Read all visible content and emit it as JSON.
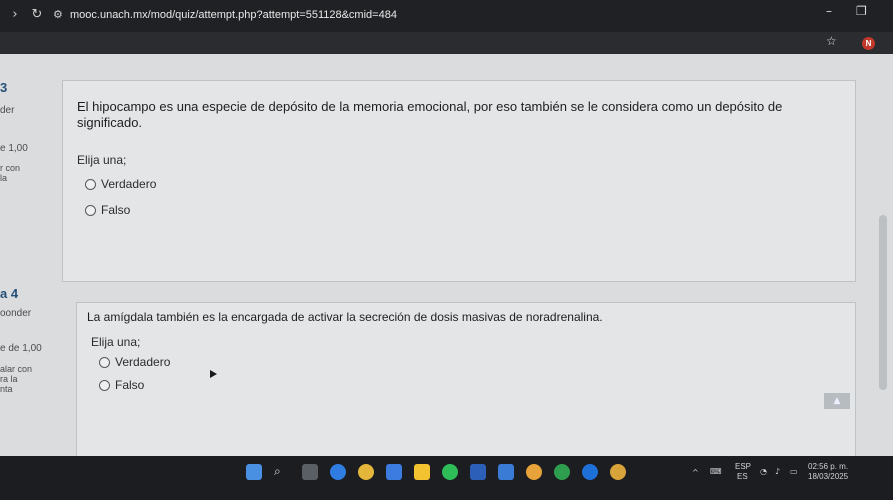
{
  "browser": {
    "url": "mooc.unach.mx/mod/quiz/attempt.php?attempt=551128&cmid=484",
    "profile_initial": "N"
  },
  "questions": [
    {
      "number": "3",
      "side_label": "der",
      "side_score": "e 1,00",
      "side_flag_1": "r con",
      "side_flag_2": "la",
      "text": "El hipocampo es una especie de depósito de la memoria emocional, por eso también se le considera como un depósito de significado.",
      "prompt": "Elija una;",
      "options": [
        "Verdadero",
        "Falso"
      ]
    },
    {
      "number": "a 4",
      "side_label": "oonder",
      "side_score": "e de 1,00",
      "side_flag_1": "alar con",
      "side_flag_2": "ra la",
      "side_flag_3": "nta",
      "text": "La amígdala también es la encargada de activar la secreción de dosis masivas de noradrenalina.",
      "prompt": "Elija una;",
      "options": [
        "Verdadero",
        "Falso"
      ]
    }
  ],
  "taskbar": {
    "lang_top": "ESP",
    "lang_bottom": "ES",
    "time": "02:56 p. m.",
    "date": "18/03/2025"
  }
}
